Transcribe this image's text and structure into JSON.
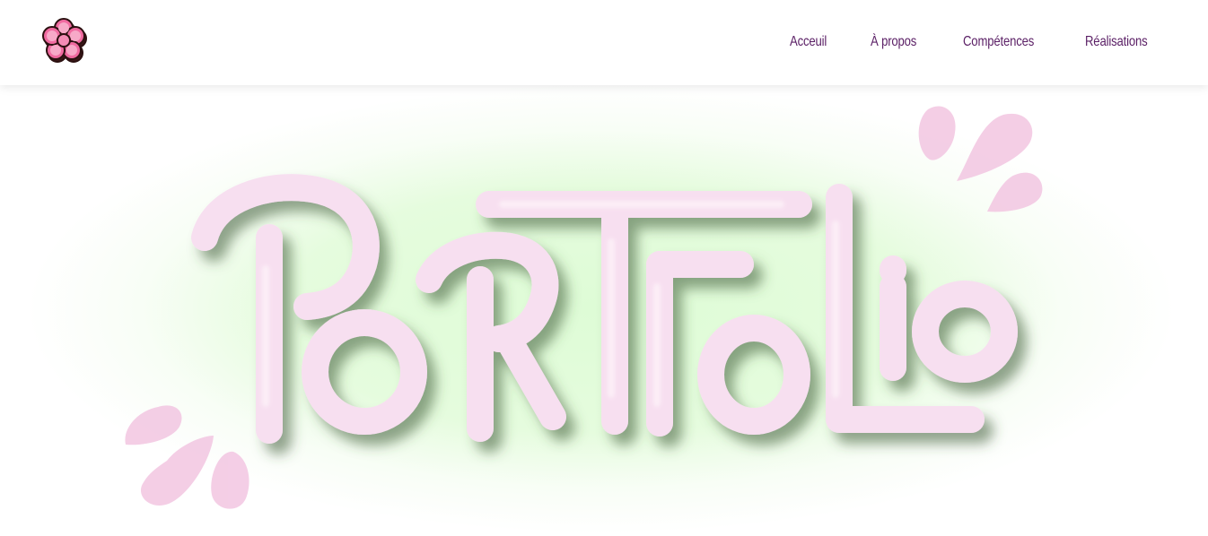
{
  "header": {
    "logo_icon": "flower-icon",
    "nav": [
      {
        "label": "Acceuil"
      },
      {
        "label": "À propos"
      },
      {
        "label": "Compétences"
      },
      {
        "label": "Réalisations"
      }
    ]
  },
  "hero": {
    "title": "PORTFOLIO",
    "colors": {
      "letters": "#f6dcee",
      "drops": "#f2c8e2",
      "background": "#e2fbd9",
      "nav_text": "#5b2066"
    }
  }
}
